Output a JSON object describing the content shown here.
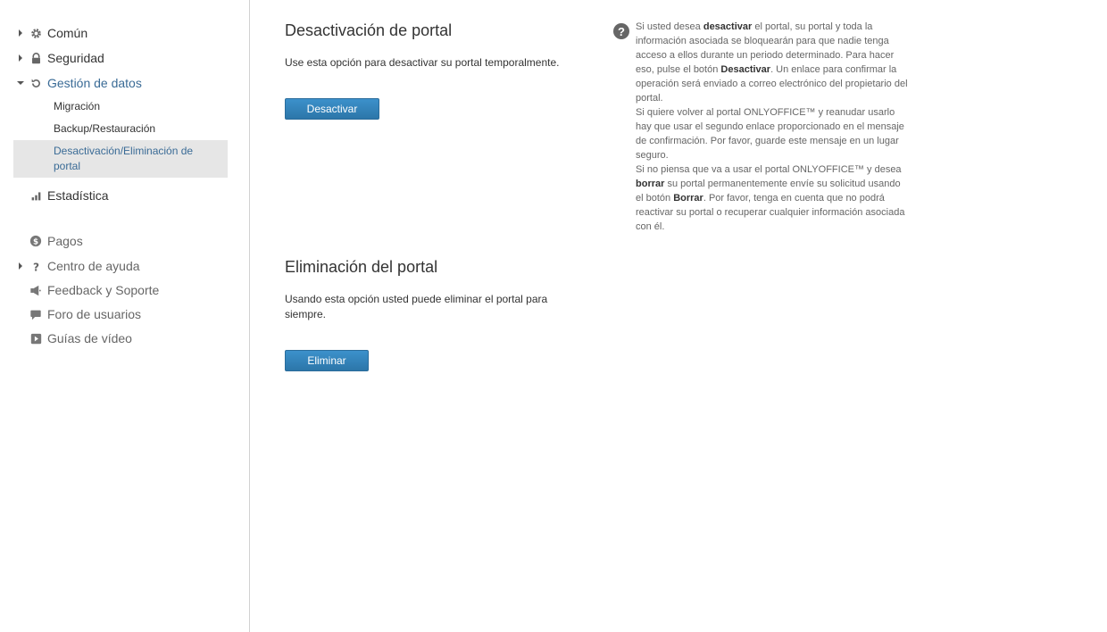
{
  "sidebar": {
    "items": [
      {
        "label": "Común",
        "icon": "gear-icon",
        "expandable": true
      },
      {
        "label": "Seguridad",
        "icon": "lock-icon",
        "expandable": true
      },
      {
        "label": "Gestión de datos",
        "icon": "restore-icon",
        "expandable": true,
        "expanded": true
      },
      {
        "label": "Estadística",
        "icon": "bar-chart-icon",
        "expandable": false
      }
    ],
    "data_subitems": [
      "Migración",
      "Backup/Restauración",
      "Desactivación/Eliminación de portal"
    ],
    "extra_items": [
      {
        "label": "Pagos",
        "icon": "dollar-icon"
      },
      {
        "label": "Centro de ayuda",
        "icon": "question-icon"
      },
      {
        "label": "Feedback y Soporte",
        "icon": "megaphone-icon"
      },
      {
        "label": "Foro de usuarios",
        "icon": "speech-bubble-icon"
      },
      {
        "label": "Guías de vídeo",
        "icon": "video-icon"
      }
    ]
  },
  "deactivation": {
    "title": "Desactivación de portal",
    "description": "Use esta opción para desactivar su portal temporalmente.",
    "button": "Desactivar"
  },
  "deletion": {
    "title": "Eliminación del portal",
    "description": "Usando esta opción usted puede eliminar el portal para siempre.",
    "button": "Eliminar"
  },
  "help": {
    "p1_a": "Si usted desea ",
    "p1_b": "desactivar",
    "p1_c": " el portal, su portal y toda la información asociada se bloquearán para que nadie tenga acceso a ellos durante un periodo determinado. Para hacer eso, pulse el botón ",
    "p1_d": "Desactivar",
    "p1_e": ". Un enlace para confirmar la operación será enviado a correo electrónico del propietario del portal.",
    "p2": "Si quiere volver al portal ONLYOFFICE™ y reanudar usarlo hay que usar el segundo enlace proporcionado en el mensaje de confirmación. Por favor, guarde este mensaje en un lugar seguro.",
    "p3_a": "Si no piensa que va a usar el portal ONLYOFFICE™ y desea ",
    "p3_b": "borrar",
    "p3_c": " su portal permanentemente envíe su solicitud usando el botón ",
    "p3_d": "Borrar",
    "p3_e": ". Por favor, tenga en cuenta que no podrá reactivar su portal o recuperar cualquier información asociada con él."
  },
  "colors": {
    "accent": "#3a6b96",
    "button": "#2f80b8",
    "selected_bg": "#e6e6e6"
  }
}
